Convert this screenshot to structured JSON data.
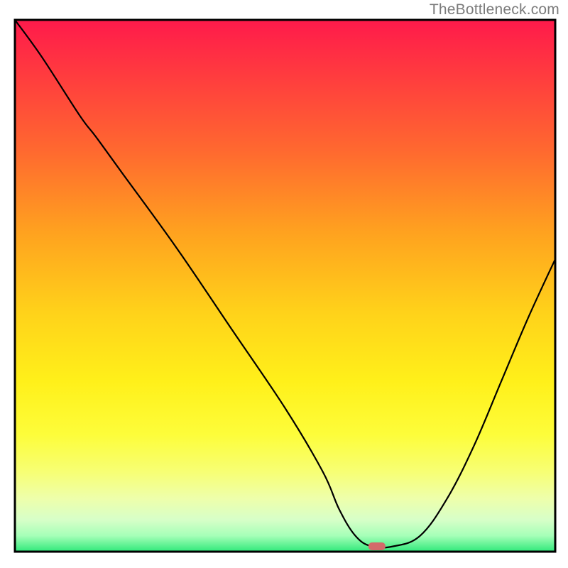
{
  "watermark": "TheBottleneck.com",
  "chart_data": {
    "type": "line",
    "title": "",
    "xlabel": "",
    "ylabel": "",
    "xlim": [
      0,
      100
    ],
    "ylim": [
      0,
      100
    ],
    "grid": false,
    "legend": false,
    "series": [
      {
        "name": "bottleneck-curve",
        "x": [
          0,
          5,
          12,
          15,
          20,
          30,
          40,
          50,
          57,
          60,
          63,
          66,
          70,
          75,
          80,
          85,
          90,
          95,
          100
        ],
        "y": [
          100,
          93,
          82,
          78,
          71,
          57,
          42,
          27,
          15,
          8,
          3,
          1,
          1,
          3,
          10,
          20,
          32,
          44,
          55
        ]
      }
    ],
    "marker": {
      "name": "target-marker",
      "x": 67,
      "y": 1,
      "color": "#d36a6a"
    },
    "background_gradient": {
      "stops": [
        {
          "offset": 0,
          "color": "#ff1a4b"
        },
        {
          "offset": 0.1,
          "color": "#ff3a3f"
        },
        {
          "offset": 0.25,
          "color": "#ff6a2f"
        },
        {
          "offset": 0.4,
          "color": "#ffa21f"
        },
        {
          "offset": 0.55,
          "color": "#ffd21a"
        },
        {
          "offset": 0.68,
          "color": "#fff01a"
        },
        {
          "offset": 0.78,
          "color": "#fdfd3a"
        },
        {
          "offset": 0.85,
          "color": "#f7ff74"
        },
        {
          "offset": 0.9,
          "color": "#eeffab"
        },
        {
          "offset": 0.94,
          "color": "#d7ffc8"
        },
        {
          "offset": 0.97,
          "color": "#a6ffb8"
        },
        {
          "offset": 1.0,
          "color": "#2fe97a"
        }
      ]
    },
    "frame_color": "#000000"
  }
}
